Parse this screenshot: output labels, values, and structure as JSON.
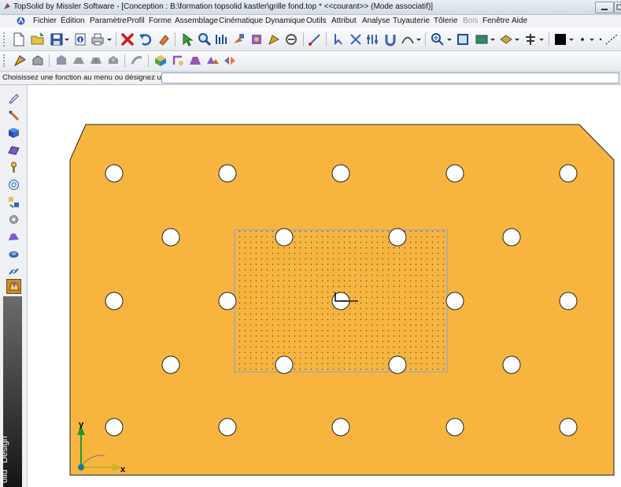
{
  "window": {
    "title": "TopSolid by Missler Software - [Conception : B:\\formation topsolid kastler\\grille fond.top * <<courant>> (Mode associatif)]"
  },
  "menu": [
    {
      "label": "Fichier",
      "disabled": false
    },
    {
      "label": "Édition",
      "disabled": false
    },
    {
      "label": "Paramètre",
      "disabled": false
    },
    {
      "label": "Profil",
      "disabled": false
    },
    {
      "label": "Forme",
      "disabled": false
    },
    {
      "label": "Assemblage",
      "disabled": false
    },
    {
      "label": "Cinématique",
      "disabled": false
    },
    {
      "label": "Dynamique",
      "disabled": false
    },
    {
      "label": "Outils",
      "disabled": false
    },
    {
      "label": "Attribut",
      "disabled": false
    },
    {
      "label": "Analyse",
      "disabled": false
    },
    {
      "label": "Tuyauterie",
      "disabled": false
    },
    {
      "label": "Tôlerie",
      "disabled": false
    },
    {
      "label": "Bois",
      "disabled": true
    },
    {
      "label": "Fenêtre",
      "disabled": false
    },
    {
      "label": "Aide",
      "disabled": false
    }
  ],
  "prompt": {
    "label": "Choisissez une fonction au menu ou désignez un élément:",
    "value": ""
  },
  "sidebar": {
    "vertical_label": "olid ' Design"
  },
  "viewport": {
    "axis_x_label": "x",
    "axis_y_label": "y",
    "part_color": "#f7b53f",
    "hole_color": "#ffffff"
  },
  "colors": {
    "accent_gold": "#f7b53f",
    "toolbar_bg": "#e6e9ee",
    "selection_frame": "#a8a8a8"
  }
}
